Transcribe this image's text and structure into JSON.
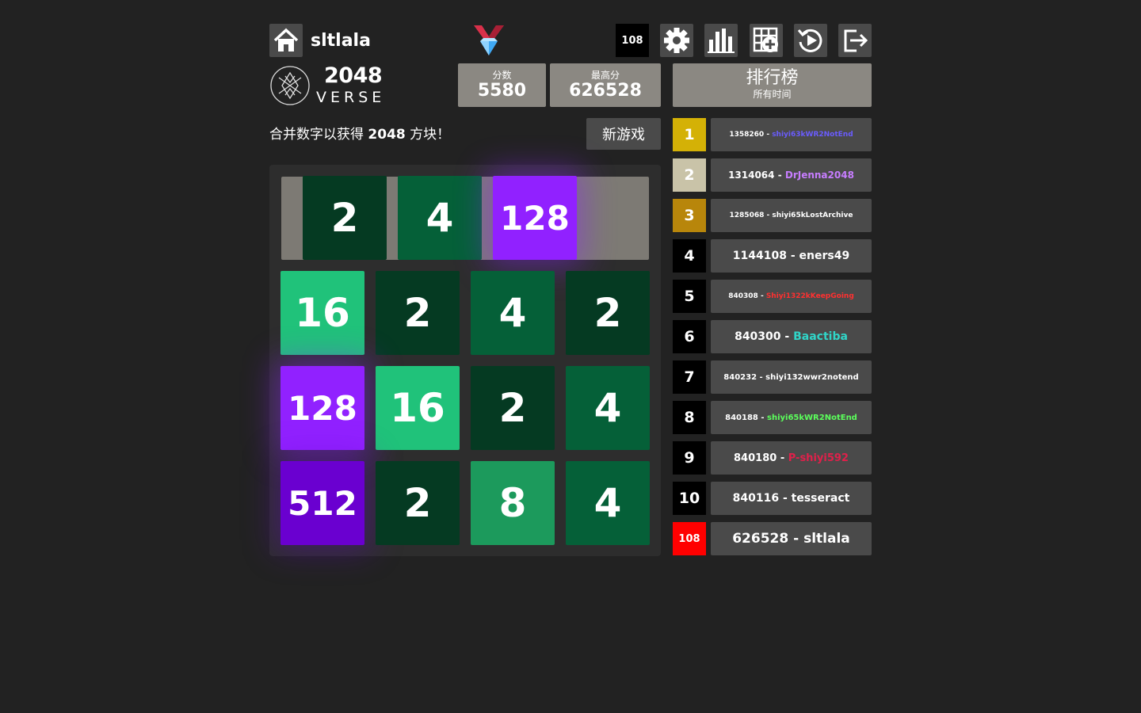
{
  "header": {
    "username": "sltlala",
    "rank_badge": "108",
    "icons": [
      "home-icon",
      "medal-icon",
      "gear-icon",
      "stats-icon",
      "grid-plus-icon",
      "replay-icon",
      "logout-icon"
    ]
  },
  "logo": {
    "title": "2048",
    "subtitle": "VERSE"
  },
  "score": {
    "label": "分数",
    "value": "5580"
  },
  "best": {
    "label": "最高分",
    "value": "626528"
  },
  "leaderboard": {
    "title": "排行榜",
    "subtitle": "所有时间",
    "entries": [
      {
        "rank": "1",
        "score": "1358260",
        "sep": " - ",
        "name": "shiyi63kWR2NotEnd",
        "name_color": "#6a5cff",
        "size": 9,
        "badge": "#d4b106"
      },
      {
        "rank": "2",
        "score": "1314064",
        "sep": " - ",
        "name": "DrJenna2048",
        "name_color": "#c77dff",
        "size": 12,
        "badge": "#c9c3a8"
      },
      {
        "rank": "3",
        "score": "1285068",
        "sep": " - ",
        "name": "shiyi65kLostArchive",
        "name_color": "#ffffff",
        "size": 9,
        "badge": "#b8860b"
      },
      {
        "rank": "4",
        "score": "1144108",
        "sep": " - ",
        "name": "eners49",
        "name_color": "#ffffff",
        "size": 14,
        "badge": "#000000"
      },
      {
        "rank": "5",
        "score": "840308",
        "sep": " - ",
        "name": "Shiyi1322kKeepGoing",
        "name_color": "#ff3030",
        "size": 9,
        "badge": "#000000"
      },
      {
        "rank": "6",
        "score": "840300",
        "sep": " - ",
        "name": "Baactiba",
        "name_color": "#30d5c8",
        "size": 14,
        "badge": "#000000"
      },
      {
        "rank": "7",
        "score": "840232",
        "sep": " - ",
        "name": "shiyi132wwr2notend",
        "name_color": "#ffffff",
        "size": 10,
        "badge": "#000000"
      },
      {
        "rank": "8",
        "score": "840188",
        "sep": " - ",
        "name": "shiyi65kWR2NotEnd",
        "name_color": "#5bff5b",
        "size": 10,
        "badge": "#000000"
      },
      {
        "rank": "9",
        "score": "840180",
        "sep": " - ",
        "name": "P-shiyi592",
        "name_color": "#e0204a",
        "size": 13,
        "badge": "#000000"
      },
      {
        "rank": "10",
        "score": "840116",
        "sep": " - ",
        "name": "tesseract",
        "name_color": "#ffffff",
        "size": 14,
        "badge": "#000000"
      },
      {
        "rank": "108",
        "score": "626528",
        "sep": " - ",
        "name": "sltlala",
        "name_color": "#ffffff",
        "size": 17,
        "badge": "#ff0000"
      }
    ]
  },
  "intro": {
    "before": "合并数字以获得 ",
    "bold": "2048",
    "after": " 方块！"
  },
  "new_game_label": "新游戏",
  "preview_tiles": [
    "2",
    "4",
    "128"
  ],
  "grid": [
    [
      "16",
      "2",
      "4",
      "2"
    ],
    [
      "128",
      "16",
      "2",
      "4"
    ],
    [
      "512",
      "2",
      "8",
      "4"
    ]
  ],
  "tile_colors": {
    "2": "#053a22",
    "4": "#056038",
    "8": "#1c9a5c",
    "16": "#20c27a",
    "128": "#9121ff",
    "512": "#6a00d0"
  }
}
